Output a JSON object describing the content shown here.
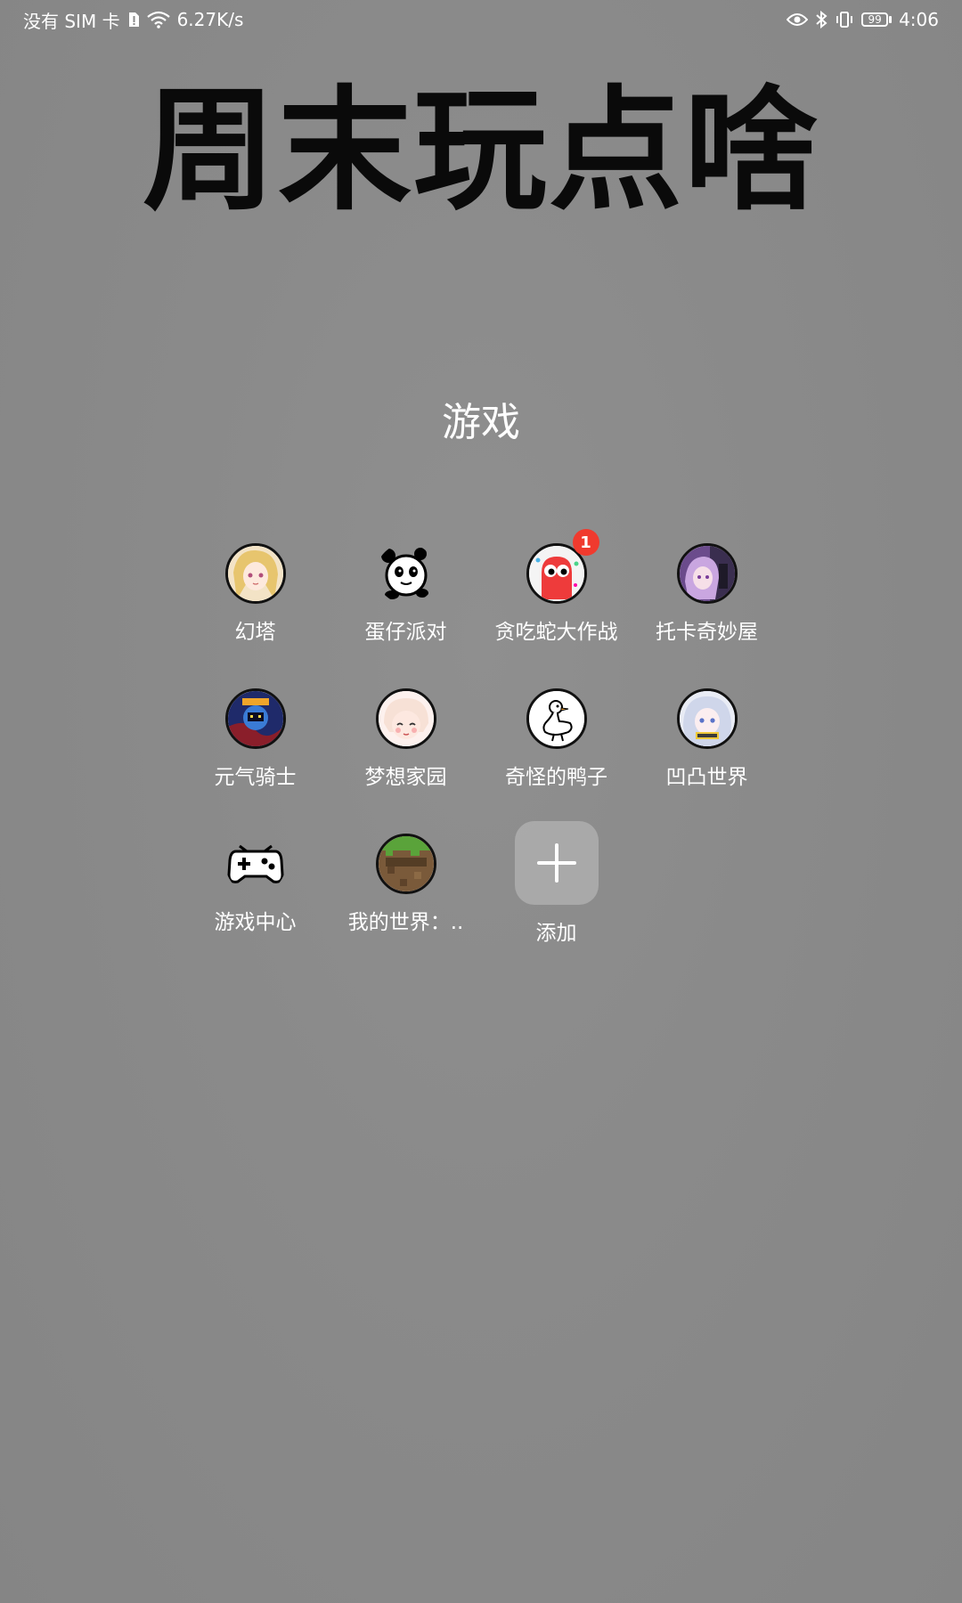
{
  "status_bar": {
    "carrier": "没有 SIM 卡",
    "speed": "6.27K/s",
    "battery": "99",
    "time": "4:06"
  },
  "headline": "周末玩点啥",
  "folder": {
    "title": "游戏",
    "apps": [
      {
        "label": "幻塔",
        "icon": "anime-girl-blonde-icon"
      },
      {
        "label": "蛋仔派对",
        "icon": "panda-mascot-icon"
      },
      {
        "label": "贪吃蛇大作战",
        "icon": "red-snake-icon",
        "badge": "1"
      },
      {
        "label": "托卡奇妙屋",
        "icon": "toca-girl-purple-icon"
      },
      {
        "label": "元气骑士",
        "icon": "soul-knight-icon"
      },
      {
        "label": "梦想家园",
        "icon": "dream-home-girl-icon"
      },
      {
        "label": "奇怪的鸭子",
        "icon": "white-duck-icon"
      },
      {
        "label": "凹凸世界",
        "icon": "anime-girl-silver-icon"
      },
      {
        "label": "游戏中心",
        "icon": "gamepad-icon"
      },
      {
        "label": "我的世界：..",
        "icon": "minecraft-grass-icon"
      }
    ],
    "add_label": "添加"
  }
}
